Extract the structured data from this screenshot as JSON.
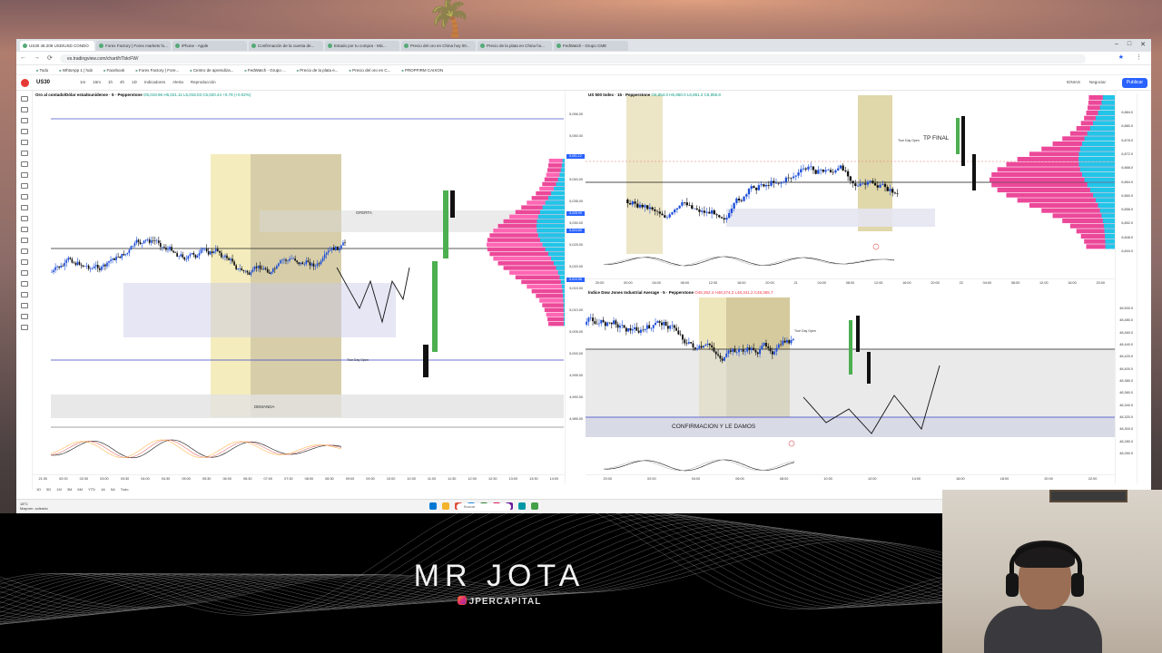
{
  "browser": {
    "tabs": [
      {
        "label": "US30 48.208 USD/USD CONDO",
        "active": true
      },
      {
        "label": "Forex Factory | Forex markets fo..."
      },
      {
        "label": "iPhone - Apple"
      },
      {
        "label": "Confirmación de la cuenta de..."
      },
      {
        "label": "Estado por tu compra - Mic..."
      },
      {
        "label": "Precio del oro en China hoy 00..."
      },
      {
        "label": "Precio de la plata en China ho..."
      },
      {
        "label": "FedWatch - Grupo CME"
      }
    ],
    "url": "es.tradingview.com/chart/hTbkrFW/",
    "bookmarks": [
      "Todo",
      "WhtsApp 1 | hub",
      "Facebook",
      "Forex Factory | Fore...",
      "Centro de aprendiza...",
      "FedWatch - Grupo ...",
      "Precio de la plata e...",
      "Precio del oro en C...",
      "PROPFIRM CAIXON"
    ]
  },
  "toolbar": {
    "symbol": "US30",
    "items": [
      "1m",
      "15m",
      "1h",
      "4h",
      "1D",
      "Indicadores",
      "Alerta",
      "Reproducción"
    ],
    "right_items": [
      "IGNIAS",
      "Negociar"
    ],
    "publish": "Publicar"
  },
  "panes": {
    "gold": {
      "title": "Oro al contado/Dólar estadounidense · 5 · Pepperstone",
      "ohlc": "O5,019.96 H5,021.11 L5,018.03 C5,020.44 +0.78 (+0.02%)",
      "labels": {
        "oferta": "OFERTA",
        "demanda": "DEMANDA",
        "true_day_open": "True Day Open"
      },
      "prices": [
        "5,056.00",
        "5,050.00",
        "5,045.00",
        "5,040.00",
        "5,035.00",
        "5,030.00",
        "5,025.00",
        "5,020.00",
        "5,015.00",
        "5,010.00",
        "5,005.00",
        "5,000.00",
        "4,995.00",
        "4,990.00",
        "4,985.00"
      ],
      "tags": [
        {
          "text": "5,051.12",
          "color": "#2962ff"
        },
        {
          "text": "5,028.99",
          "color": "#2962ff"
        },
        {
          "text": "5,024.80",
          "color": "#2962ff"
        },
        {
          "text": "5,010.55",
          "color": "#2962ff"
        }
      ],
      "times": [
        "21:30",
        "02:00",
        "02:30",
        "03:00",
        "03:30",
        "04:00",
        "04:30",
        "05:00",
        "05:30",
        "06:00",
        "06:30",
        "07:00",
        "07:30",
        "08:00",
        "08:30",
        "09:00",
        "09:30",
        "10:00",
        "10:30",
        "11:00",
        "11:30",
        "12:00",
        "12:30",
        "13:00",
        "13:30",
        "14:00"
      ],
      "ranges": [
        "1D",
        "5D",
        "1M",
        "3M",
        "6M",
        "YTD",
        "1A",
        "5A",
        "Todo"
      ]
    },
    "sp500": {
      "title": "US 500 Index · 15 · Pepperstone",
      "ohlc": "O6,854.0 H6,860.0 L6,851.2 C6,855.8",
      "labels": {
        "tp_final": "TP FINAL",
        "true_day_open": "True Day Open"
      },
      "prices": [
        "6,884.0",
        "6,880.0",
        "6,876.0",
        "6,872.0",
        "6,868.0",
        "6,864.0",
        "6,860.0",
        "6,856.0",
        "6,852.0",
        "6,848.0",
        "6,844.0"
      ],
      "times": [
        "20:00",
        "00:00",
        "04:00",
        "08:00",
        "12:00",
        "16:00",
        "20:00",
        "21",
        "04:00",
        "08:00",
        "12:00",
        "16:00",
        "20:00",
        "22",
        "04:00",
        "08:00",
        "12:00",
        "16:00",
        "20:00"
      ]
    },
    "dow": {
      "title": "Índice Dow Jones Industrial Average · 5 · Pepperstone",
      "ohlc": "O48,352.4 H48,374.2 L48,341.2 C48,365.7",
      "labels": {
        "confirmacion": "CONFIRMACION Y LE DAMOS",
        "true_day_open": "True Day Open"
      },
      "prices": [
        "48,500.0",
        "48,480.0",
        "48,460.0",
        "48,440.0",
        "48,420.0",
        "48,400.0",
        "48,380.0",
        "48,360.0",
        "48,340.0",
        "48,320.0",
        "48,300.0",
        "48,280.0",
        "48,260.0"
      ],
      "times": [
        "20:00",
        "02:00",
        "04:00",
        "06:00",
        "08:00",
        "10:00",
        "12:00",
        "14:00",
        "16:00",
        "18:00",
        "20:00",
        "22:00"
      ]
    }
  },
  "taskbar": {
    "weather_temp": "18°C",
    "weather_desc": "Mayorm. soleado",
    "search": "Buscar"
  },
  "banner": {
    "brand": "MR JOTA",
    "handle": "JPERCAPITAL"
  }
}
